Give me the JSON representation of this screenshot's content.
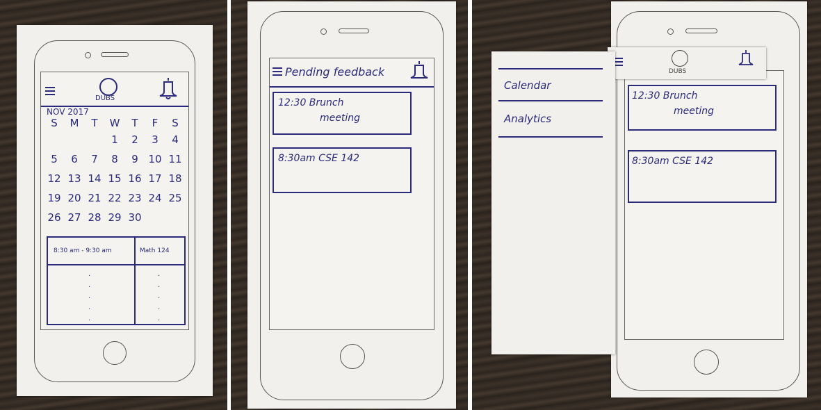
{
  "panel1": {
    "title": "DUBS",
    "month": "NOV 2017",
    "weekdays": [
      "S",
      "M",
      "T",
      "W",
      "T",
      "F",
      "S"
    ],
    "days": [
      [
        "",
        "",
        "",
        "",
        "1",
        "2",
        "3",
        "4"
      ],
      [
        "5",
        "6",
        "7",
        "8",
        "9",
        "10",
        "11"
      ],
      [
        "12",
        "13",
        "14",
        "15",
        "16",
        "17",
        "18"
      ],
      [
        "19",
        "20",
        "21",
        "22",
        "23",
        "24",
        "25"
      ],
      [
        "26",
        "27",
        "28",
        "29",
        "30"
      ]
    ],
    "event": {
      "time": "8:30 am - 9:30 am",
      "name": "Math 124"
    }
  },
  "panel2": {
    "title": "Pending feedback",
    "cards": [
      {
        "line1": "12:30 Brunch",
        "line2": "meeting"
      },
      {
        "line1": "8:30am CSE 142",
        "line2": ""
      }
    ]
  },
  "panel3": {
    "title": "DUBS",
    "menu": [
      "Calendar",
      "Analytics"
    ],
    "cards": [
      {
        "line1": "12:30 Brunch",
        "line2": "meeting"
      },
      {
        "line1": "8:30am CSE 142",
        "line2": ""
      }
    ]
  },
  "icons": {
    "menu": "hamburger-icon",
    "notifications": "bell-icon",
    "logo": "dubs-logo-icon",
    "home": "home-button-icon"
  },
  "colors": {
    "ink": "#2b2a7a",
    "paper": "#f1f0ec",
    "table": "#3b3128"
  }
}
